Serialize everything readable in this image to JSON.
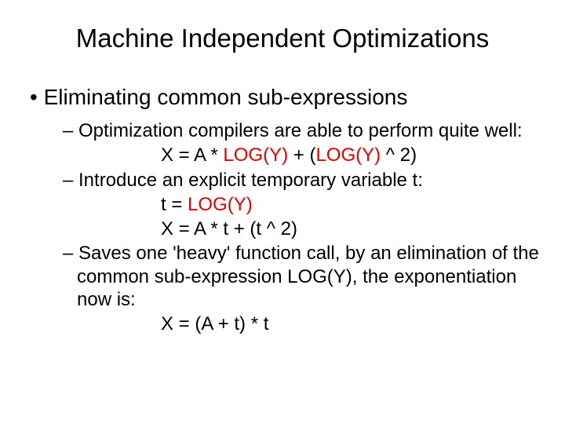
{
  "title": "Machine Independent Optimizations",
  "b1": "Eliminating common sub-expressions",
  "b2a": "Optimization compilers are able to perform quite well:",
  "expr1_a": "X = A * ",
  "expr1_b": "LOG(Y)",
  "expr1_c": " + (",
  "expr1_d": "LOG(Y)",
  "expr1_e": " ^ 2)",
  "b2b": "Introduce an explicit temporary variable t:",
  "expr2_a": "t = ",
  "expr2_b": "LOG(Y)",
  "expr3": "X = A * t + (t ^ 2)",
  "b2c": "Saves one 'heavy' function call, by an elimination of the common sub-expression LOG(Y), the exponentiation now is:",
  "expr4": "X = (A + t) * t"
}
